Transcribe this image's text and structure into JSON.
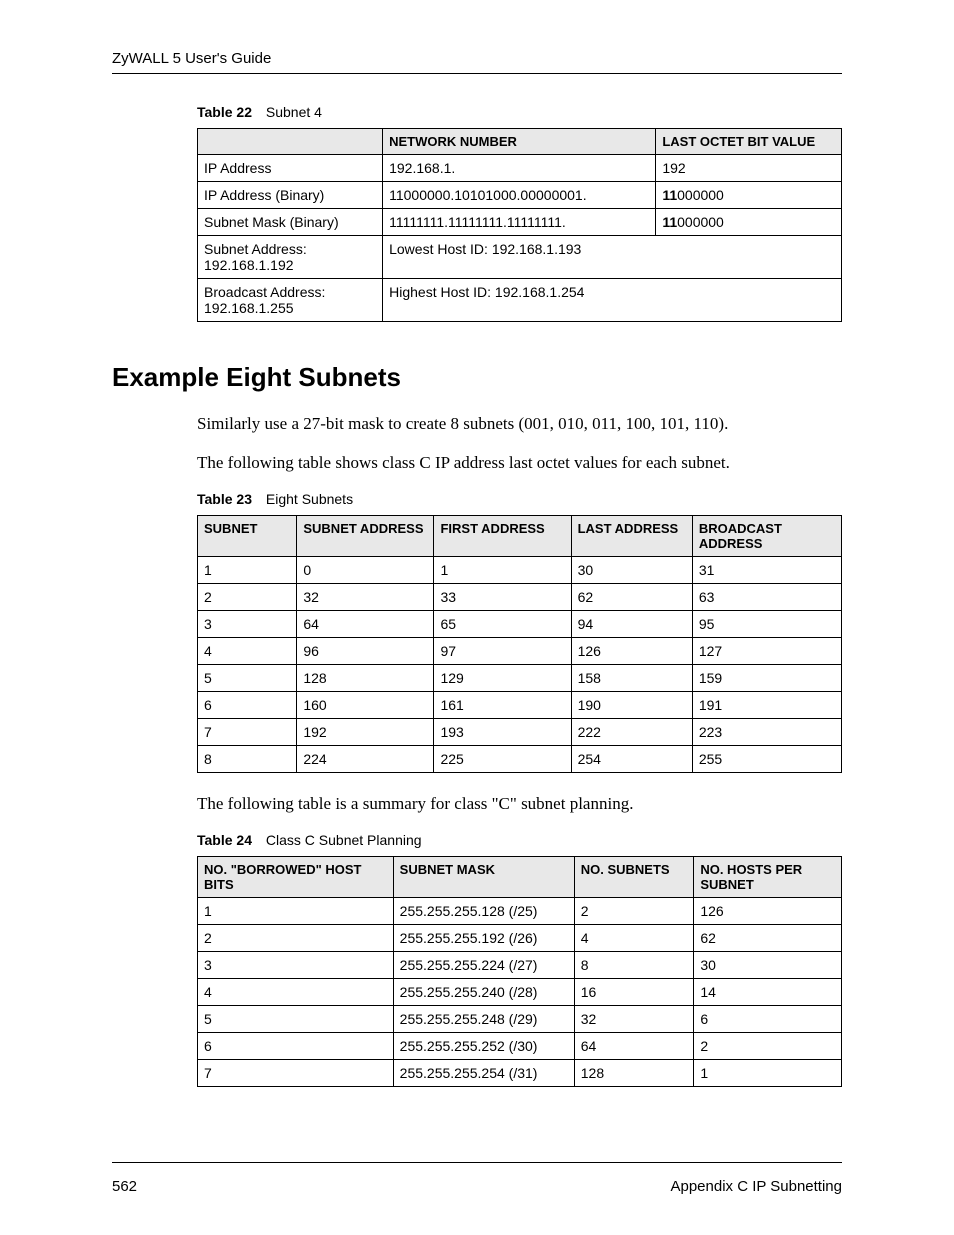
{
  "header": {
    "guide": "ZyWALL 5 User's Guide"
  },
  "table22": {
    "caption_num": "Table 22",
    "caption_title": "Subnet 4",
    "head": {
      "c0": "",
      "c1": "NETWORK NUMBER",
      "c2": "LAST OCTET BIT VALUE"
    },
    "rows": [
      {
        "label": "IP Address",
        "net": "192.168.1.",
        "last": "192",
        "bold": ""
      },
      {
        "label": "IP Address (Binary)",
        "net": "11000000.10101000.00000001.",
        "last": "000000",
        "bold": "11"
      },
      {
        "label": "Subnet Mask (Binary)",
        "net": "11111111.11111111.11111111.",
        "last": "000000",
        "bold": "11"
      }
    ],
    "span_rows": [
      {
        "label": "Subnet Address: 192.168.1.192",
        "val": "Lowest Host ID: 192.168.1.193"
      },
      {
        "label": "Broadcast Address: 192.168.1.255",
        "val": "Highest Host ID: 192.168.1.254"
      }
    ]
  },
  "section_heading": "Example Eight Subnets",
  "para1": "Similarly use a 27-bit mask to create 8 subnets (001, 010, 011, 100, 101, 110).",
  "para2": "The following table shows class C IP address last octet values for each subnet.",
  "table23": {
    "caption_num": "Table 23",
    "caption_title": "Eight Subnets",
    "head": [
      "SUBNET",
      "SUBNET ADDRESS",
      "FIRST ADDRESS",
      "LAST ADDRESS",
      "BROADCAST ADDRESS"
    ],
    "rows": [
      [
        "1",
        "0",
        "1",
        "30",
        "31"
      ],
      [
        "2",
        "32",
        "33",
        "62",
        "63"
      ],
      [
        "3",
        "64",
        "65",
        "94",
        "95"
      ],
      [
        "4",
        "96",
        "97",
        "126",
        "127"
      ],
      [
        "5",
        "128",
        "129",
        "158",
        "159"
      ],
      [
        "6",
        "160",
        "161",
        "190",
        "191"
      ],
      [
        "7",
        "192",
        "193",
        "222",
        "223"
      ],
      [
        "8",
        "224",
        "225",
        "254",
        "255"
      ]
    ]
  },
  "para3": "The following table is a summary for class \"C\" subnet planning.",
  "table24": {
    "caption_num": "Table 24",
    "caption_title": "Class C Subnet Planning",
    "head": [
      "NO. \"BORROWED\" HOST BITS",
      "SUBNET MASK",
      "NO. SUBNETS",
      "NO. HOSTS PER SUBNET"
    ],
    "rows": [
      [
        "1",
        "255.255.255.128 (/25)",
        "2",
        "126"
      ],
      [
        "2",
        "255.255.255.192 (/26)",
        "4",
        "62"
      ],
      [
        "3",
        "255.255.255.224 (/27)",
        "8",
        "30"
      ],
      [
        "4",
        "255.255.255.240 (/28)",
        "16",
        "14"
      ],
      [
        "5",
        "255.255.255.248 (/29)",
        "32",
        "6"
      ],
      [
        "6",
        "255.255.255.252 (/30)",
        "64",
        "2"
      ],
      [
        "7",
        "255.255.255.254 (/31)",
        "128",
        "1"
      ]
    ]
  },
  "footer": {
    "page": "562",
    "appendix": "Appendix C IP Subnetting"
  }
}
